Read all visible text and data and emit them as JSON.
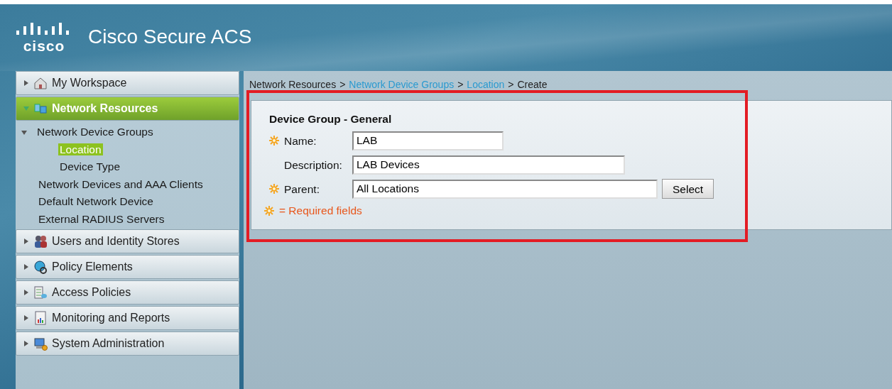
{
  "header": {
    "logo_text": "cisco",
    "title": "Cisco Secure ACS"
  },
  "sidebar": {
    "sections": [
      {
        "label": "My Workspace",
        "kind": "workspace",
        "expanded": false,
        "selected": false
      },
      {
        "label": "Network Resources",
        "kind": "network",
        "expanded": true,
        "selected": true,
        "children": [
          {
            "label": "Network Device Groups",
            "expanded": true,
            "selected": false,
            "children": [
              {
                "label": "Location",
                "selected": true
              },
              {
                "label": "Device Type",
                "selected": false
              }
            ]
          },
          {
            "label": "Network Devices and AAA Clients",
            "selected": false
          },
          {
            "label": "Default Network Device",
            "selected": false
          },
          {
            "label": "External RADIUS Servers",
            "selected": false
          }
        ]
      },
      {
        "label": "Users and Identity Stores",
        "kind": "users",
        "expanded": false,
        "selected": false
      },
      {
        "label": "Policy Elements",
        "kind": "policy",
        "expanded": false,
        "selected": false
      },
      {
        "label": "Access Policies",
        "kind": "access",
        "expanded": false,
        "selected": false
      },
      {
        "label": "Monitoring and Reports",
        "kind": "monitoring",
        "expanded": false,
        "selected": false
      },
      {
        "label": "System Administration",
        "kind": "admin",
        "expanded": false,
        "selected": false
      }
    ]
  },
  "breadcrumb": [
    {
      "label": "Network Resources",
      "link": false,
      "separator": ">"
    },
    {
      "label": "Network Device Groups",
      "link": true,
      "separator": ">"
    },
    {
      "label": "Location",
      "link": true,
      "separator": ">"
    },
    {
      "label": "Create",
      "link": false
    }
  ],
  "form": {
    "title": "Device Group - General",
    "highlighted": true,
    "fields": [
      {
        "label": "Name:",
        "value": "LAB",
        "required": true
      },
      {
        "label": "Description:",
        "value": "LAB Devices",
        "required": false
      },
      {
        "label": "Parent:",
        "value": "All Locations",
        "required": true,
        "button": "Select"
      }
    ],
    "legend": "= Required fields"
  }
}
